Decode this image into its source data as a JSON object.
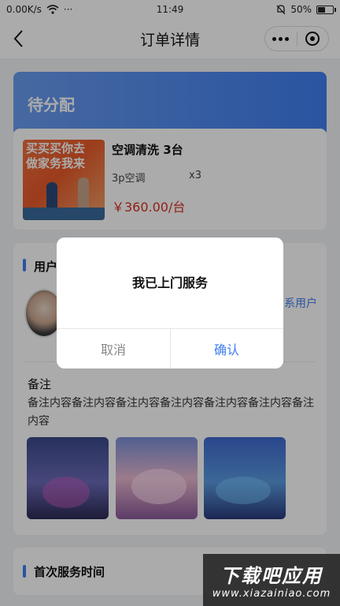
{
  "status_bar": {
    "network_speed": "0.00K/s",
    "more": "···",
    "time": "11:49",
    "battery": "50%",
    "battery_level": 0.5
  },
  "nav": {
    "title": "订单详情"
  },
  "order": {
    "status": "待分配",
    "product": {
      "title": "空调清洗  3台",
      "spec": "3p空调",
      "quantity": "x3",
      "price": "￥360.00/台",
      "image_text": [
        "买买买你去",
        "做家务我来"
      ]
    }
  },
  "user_section": {
    "title": "用户",
    "contact_label": "系用户"
  },
  "remark": {
    "label": "备注",
    "text": "备注内容备注内容备注内容备注内容备注内容备注内容备注内容"
  },
  "first_service": {
    "title": "首次服务时间"
  },
  "dialog": {
    "message": "我已上门服务",
    "cancel_label": "取消",
    "confirm_label": "确认"
  },
  "watermark": {
    "title": "下载吧应用",
    "url": "www.xiazainiao.com"
  },
  "colors": {
    "accent": "#3f7ef0",
    "price": "#d9301f"
  }
}
